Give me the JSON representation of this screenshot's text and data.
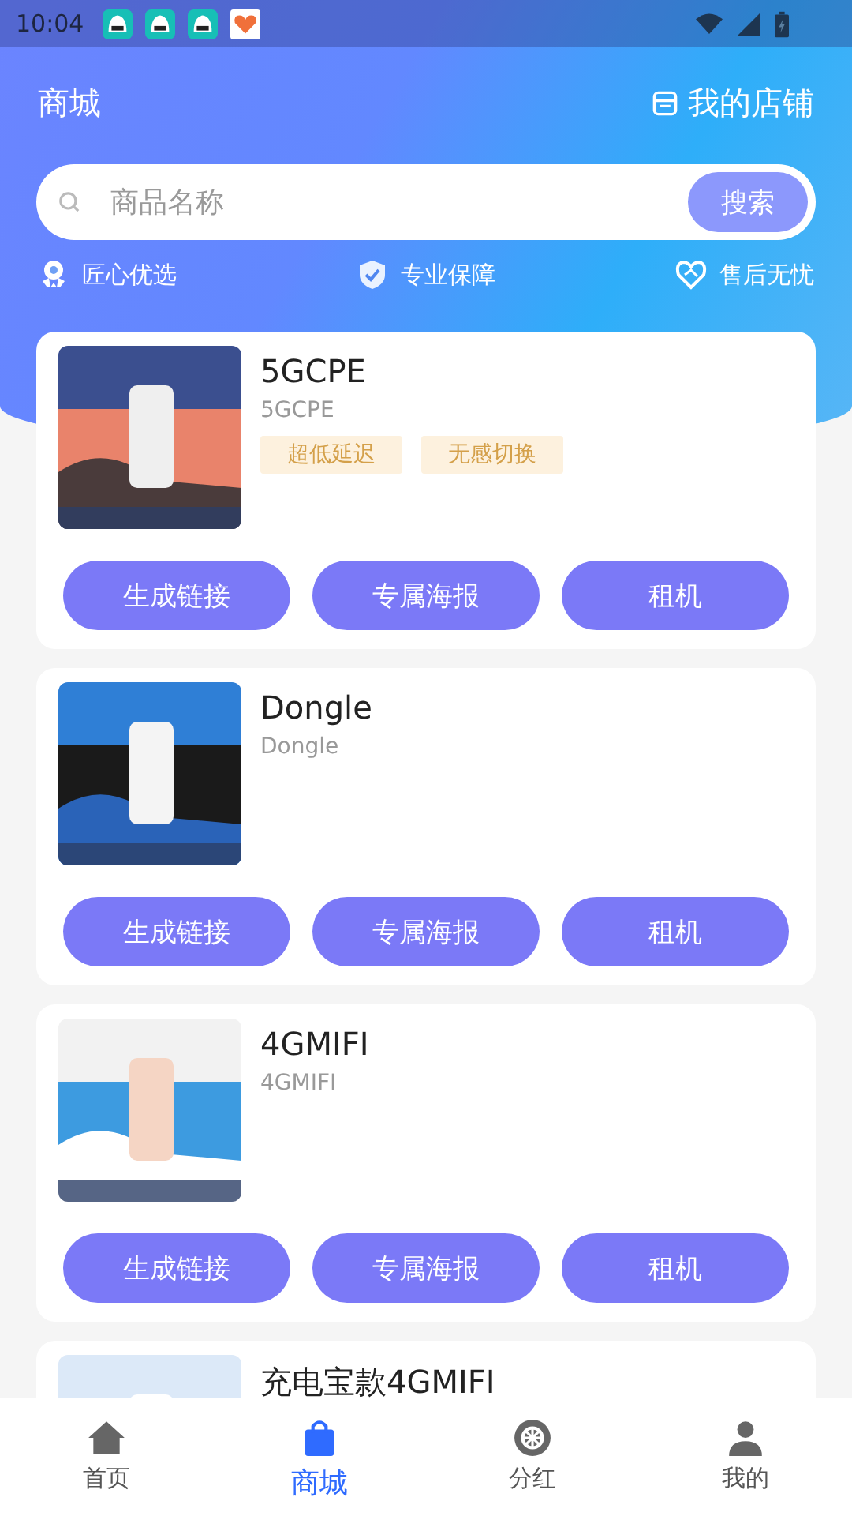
{
  "status_bar": {
    "time": "10:04"
  },
  "header": {
    "title": "商城",
    "store_link": "我的店铺"
  },
  "search": {
    "placeholder": "商品名称",
    "button": "搜索"
  },
  "features": [
    {
      "kind": "award",
      "label": "匠心优选"
    },
    {
      "kind": "shield",
      "label": "专业保障"
    },
    {
      "kind": "heart",
      "label": "售后无忧"
    }
  ],
  "products": [
    {
      "name": "5GCPE",
      "subtitle": "5GCPE",
      "tags": [
        "超低延迟",
        "无感切换"
      ],
      "actions": [
        "生成链接",
        "专属海报",
        "租机"
      ]
    },
    {
      "name": "Dongle",
      "subtitle": "Dongle",
      "actions": [
        "生成链接",
        "专属海报",
        "租机"
      ]
    },
    {
      "name": "4GMIFI",
      "subtitle": "4GMIFI",
      "actions": [
        "生成链接",
        "专属海报",
        "租机"
      ]
    },
    {
      "name": "充电宝款4GMIFI"
    }
  ],
  "nav": [
    {
      "kind": "home",
      "label": "首页",
      "selected": false
    },
    {
      "kind": "bag",
      "label": "商城",
      "selected": true
    },
    {
      "kind": "wheel",
      "label": "分红",
      "selected": false
    },
    {
      "kind": "person",
      "label": "我的",
      "selected": false
    }
  ]
}
